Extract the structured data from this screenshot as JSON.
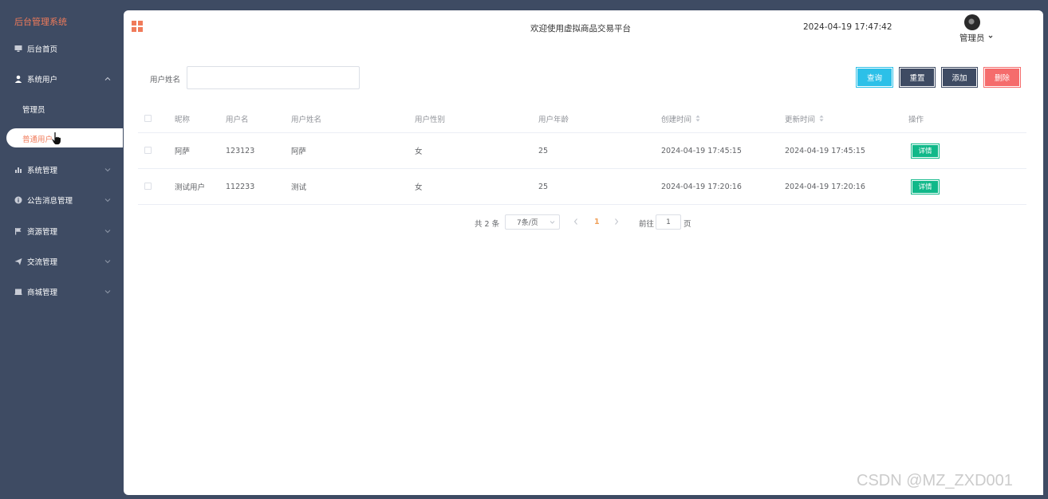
{
  "app": {
    "brand": "后台管理系统"
  },
  "header": {
    "title": "欢迎使用虚拟商品交易平台",
    "datetime": "2024-04-19 17:47:42",
    "user": "管理员"
  },
  "sidebar": {
    "items": [
      {
        "label": "后台首页",
        "icon": "monitor-icon"
      },
      {
        "label": "系统用户",
        "icon": "user-icon",
        "expanded": true
      },
      {
        "label": "系统管理",
        "icon": "bar-chart-icon"
      },
      {
        "label": "公告消息管理",
        "icon": "info-icon"
      },
      {
        "label": "资源管理",
        "icon": "flag-icon"
      },
      {
        "label": "交流管理",
        "icon": "send-icon"
      },
      {
        "label": "商城管理",
        "icon": "shop-icon"
      }
    ],
    "subitems": [
      {
        "label": "管理员",
        "active": false
      },
      {
        "label": "普通用户",
        "active": true
      }
    ]
  },
  "search": {
    "label": "用户姓名",
    "value": "",
    "placeholder": ""
  },
  "toolbar": {
    "query_label": "查询",
    "reset_label": "重置",
    "add_label": "添加",
    "delete_label": "删除"
  },
  "colors": {
    "sidebar_bg": "#3e4b63",
    "accent": "#f07b5a",
    "query": "#2cc0e8",
    "delete": "#f56c6c",
    "detail": "#10b889"
  },
  "table": {
    "columns": [
      "昵称",
      "用户名",
      "用户姓名",
      "用户性别",
      "用户年龄",
      "创建时间",
      "更新时间",
      "操作"
    ],
    "rows": [
      [
        "阿萨",
        "123123",
        "阿萨",
        "女",
        "25",
        "2024-04-19 17:45:15",
        "2024-04-19 17:45:15"
      ],
      [
        "测试用户",
        "112233",
        "测试",
        "女",
        "25",
        "2024-04-19 17:20:16",
        "2024-04-19 17:20:16"
      ]
    ],
    "action_label": "详情"
  },
  "pagination": {
    "total": "共 2 条",
    "page_size": "7条/页",
    "current_page": "1",
    "goto_label": "前往",
    "goto_value": "1",
    "page_suffix": "页"
  },
  "watermark": "CSDN @MZ_ZXD001"
}
